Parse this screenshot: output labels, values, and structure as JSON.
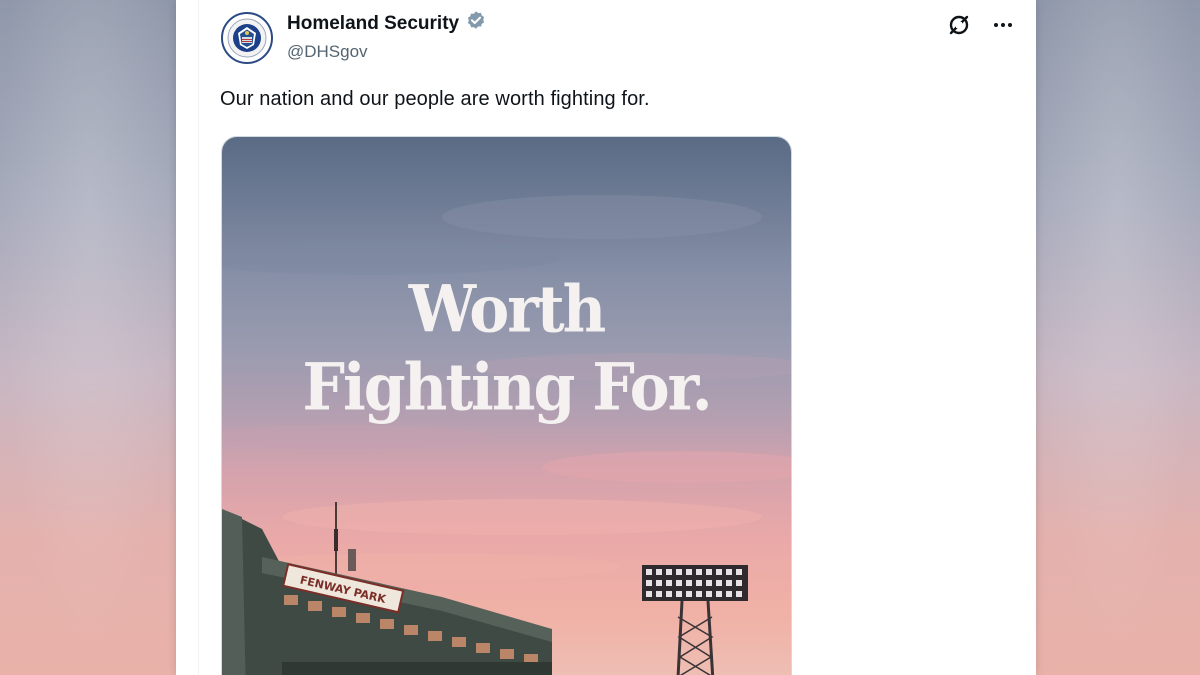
{
  "account": {
    "display_name": "Homeland Security",
    "handle": "@DHSgov",
    "verified_icon": "verified-badge-icon",
    "avatar_icon": "dhs-seal-icon"
  },
  "actions": {
    "grok_icon": "grok-icon",
    "more_icon": "more-icon"
  },
  "tweet": {
    "text": "Our nation and our people are worth fighting for."
  },
  "media": {
    "headline_line1": "Worth",
    "headline_line2": "Fighting For.",
    "sign_text": "FENWAY PARK"
  },
  "colors": {
    "verified": "#829aab",
    "text_primary": "#0f1419",
    "text_secondary": "#536471"
  }
}
